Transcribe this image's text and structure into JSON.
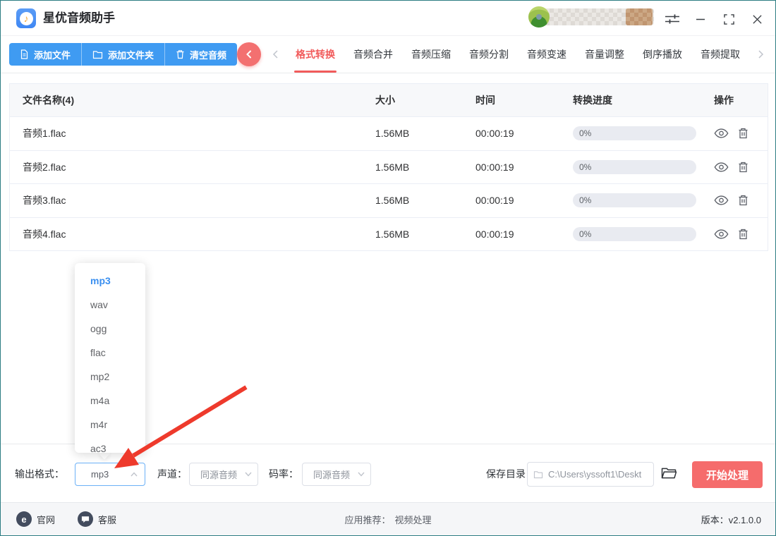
{
  "window": {
    "title": "星优音频助手"
  },
  "toolbar": {
    "add_file": "添加文件",
    "add_folder": "添加文件夹",
    "clear_audio": "清空音频"
  },
  "tabs": {
    "active": "格式转换",
    "items": [
      "格式转换",
      "音频合并",
      "音频压缩",
      "音频分割",
      "音频变速",
      "音量调整",
      "倒序播放",
      "音频提取"
    ]
  },
  "table": {
    "headers": {
      "name": "文件名称(4)",
      "size": "大小",
      "time": "时间",
      "progress": "转换进度",
      "actions": "操作"
    },
    "rows": [
      {
        "name": "音频1.flac",
        "size": "1.56MB",
        "time": "00:00:19",
        "progress": "0%"
      },
      {
        "name": "音频2.flac",
        "size": "1.56MB",
        "time": "00:00:19",
        "progress": "0%"
      },
      {
        "name": "音频3.flac",
        "size": "1.56MB",
        "time": "00:00:19",
        "progress": "0%"
      },
      {
        "name": "音频4.flac",
        "size": "1.56MB",
        "time": "00:00:19",
        "progress": "0%"
      }
    ]
  },
  "dropdown": {
    "selected": "mp3",
    "options": [
      "mp3",
      "wav",
      "ogg",
      "flac",
      "mp2",
      "m4a",
      "m4r",
      "ac3"
    ]
  },
  "bottom": {
    "output_format_label": "输出格式：",
    "output_format_value": "mp3",
    "channel_label": "声道：",
    "channel_value": "同源音频",
    "bitrate_label": "码率：",
    "bitrate_value": "同源音频",
    "save_dir_label": "保存目录：",
    "save_dir_value": "C:\\Users\\yssoft1\\Deskt",
    "start_button": "开始处理"
  },
  "footer": {
    "website": "官网",
    "website_icon_letter": "e",
    "support": "客服",
    "recommend_label": "应用推荐：",
    "recommend_link": "视频处理",
    "version": "版本：v2.1.0.0"
  },
  "icons": {
    "app": "music-note",
    "titlebar_right": [
      "sliders",
      "minimize",
      "maximize",
      "close"
    ],
    "toolbar": [
      "file",
      "folder",
      "trash"
    ],
    "row_actions": [
      "eye",
      "trash"
    ],
    "save_dir": [
      "folder-small",
      "folder-open"
    ]
  },
  "colors": {
    "primary_blue": "#3f9bf2",
    "accent_red": "#f56c6c",
    "active_tab_red": "#f15b5b",
    "link_blue": "#3a8ff0",
    "arrow_red": "#ee3a2c",
    "progress_bg": "#e9ebf1"
  }
}
